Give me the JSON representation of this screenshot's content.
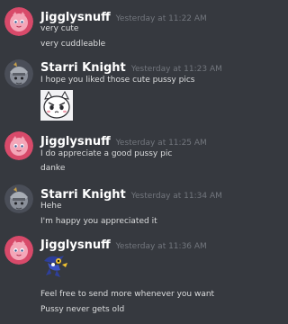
{
  "messages": [
    {
      "username": "Jigglysnuff",
      "timestamp": "Yesterday at 11:22 AM",
      "lines": [
        "very cute",
        "very cuddleable"
      ],
      "avatar_icon": "jigglypuff-avatar-icon"
    },
    {
      "username": "Starri Knight",
      "timestamp": "Yesterday at 11:23 AM",
      "lines": [
        "I hope you liked those cute pussy pics"
      ],
      "avatar_icon": "knight-avatar-icon",
      "emote_icon": "angry-cat-emote-icon"
    },
    {
      "username": "Jigglysnuff",
      "timestamp": "Yesterday at 11:25 AM",
      "lines": [
        "I do appreciate a good pussy pic",
        "danke"
      ],
      "avatar_icon": "jigglypuff-avatar-icon"
    },
    {
      "username": "Starri Knight",
      "timestamp": "Yesterday at 11:34 AM",
      "lines": [
        "Hehe",
        "I'm happy you appreciated it"
      ],
      "avatar_icon": "knight-avatar-icon"
    },
    {
      "username": "Jigglysnuff",
      "timestamp": "Yesterday at 11:36 AM",
      "lines": [
        "Feel free to send more whenever you want",
        "Pussy never gets old"
      ],
      "avatar_icon": "jigglypuff-avatar-icon",
      "emote_icon": "pokemon-sticker-emote-icon"
    }
  ],
  "colors": {
    "background": "#36393f",
    "username": "#ffffff",
    "timestamp": "#72767d",
    "message_text": "#dcddde"
  }
}
